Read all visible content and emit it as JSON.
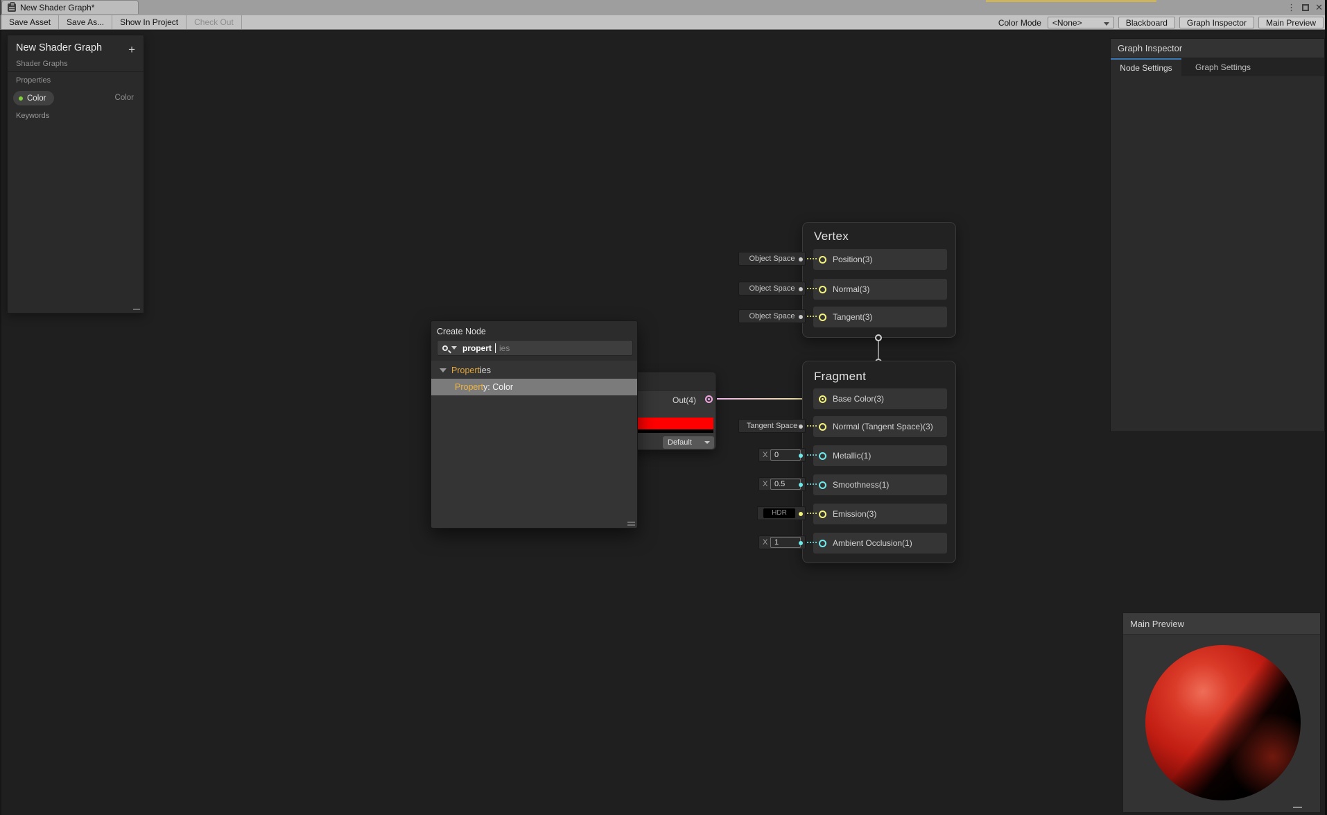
{
  "window": {
    "tab_title": "New Shader Graph*",
    "more_icon": "⋮",
    "close_icon": "✕"
  },
  "toolbar": {
    "save_asset": "Save Asset",
    "save_as": "Save As...",
    "show_in_project": "Show In Project",
    "check_out": "Check Out",
    "color_mode_label": "Color Mode",
    "color_mode_value": "<None>",
    "blackboard": "Blackboard",
    "graph_inspector": "Graph Inspector",
    "main_preview": "Main Preview"
  },
  "blackboard": {
    "title": "New Shader Graph",
    "subtitle": "Shader Graphs",
    "add_button": "+",
    "properties_label": "Properties",
    "keywords_label": "Keywords",
    "property": {
      "name": "Color",
      "type": "Color"
    }
  },
  "create_node": {
    "title": "Create Node",
    "search_typed": "propert",
    "search_hint": "ies",
    "group_match": "Propert",
    "group_rest": "ies",
    "result_match": "Propert",
    "result_rest": "y: Color"
  },
  "color_node": {
    "out_label": "Out(4)",
    "default_label": "Default",
    "swatch_color": "#ff0000"
  },
  "vertex_node": {
    "title": "Vertex",
    "rows": [
      {
        "label": "Position(3)",
        "space": "Object Space"
      },
      {
        "label": "Normal(3)",
        "space": "Object Space"
      },
      {
        "label": "Tangent(3)",
        "space": "Object Space"
      }
    ]
  },
  "fragment_node": {
    "title": "Fragment",
    "x_label": "X",
    "rows": [
      {
        "label": "Base Color(3)"
      },
      {
        "label": "Normal (Tangent Space)(3)",
        "space": "Tangent Space"
      },
      {
        "label": "Metallic(1)",
        "value": "0"
      },
      {
        "label": "Smoothness(1)",
        "value": "0.5"
      },
      {
        "label": "Emission(3)",
        "hdr": "HDR"
      },
      {
        "label": "Ambient Occlusion(1)",
        "value": "1"
      }
    ]
  },
  "inspector": {
    "title": "Graph Inspector",
    "tab_node_settings": "Node Settings",
    "tab_graph_settings": "Graph Settings"
  },
  "preview": {
    "title": "Main Preview"
  },
  "colors": {
    "accent_blue": "#3d7ab5",
    "port_vec3_yellow": "#f3f37c",
    "port_scalar_cyan": "#6fe9ea",
    "port_vec4_pink": "#f2a7e3",
    "wire_start_pink": "#f0b8e8",
    "wire_end_yellow": "#e9e897",
    "swatch_red": "#ff0000",
    "property_dot_green": "#7fd13b",
    "search_match_orange": "#e3a73c"
  }
}
